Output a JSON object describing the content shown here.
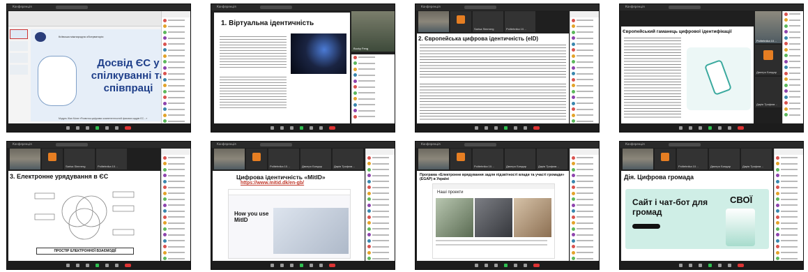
{
  "screenshot": {
    "title": "Zoom gallery of 8 shared-screen presentation captures"
  },
  "tiles": [
    {
      "id": "t1",
      "zoom_title": "Конференція",
      "slide_title_lines": [
        "Досвід ЄС у",
        "спілкуванні та",
        "співпраці"
      ],
      "slide_org": "Київська міжнародна обсерваторія",
      "slide_footer": "Модуль Жан Моне «Розвиток цифрових компетентностей фахових кадрів ЄС…»",
      "accent_color": "#3a4fa8"
    },
    {
      "id": "t2",
      "zoom_title": "Конференція",
      "slide_title": "1. Віртуальна ідентичність",
      "participants_visible": [
        "Bucky Feng"
      ]
    },
    {
      "id": "t3",
      "zoom_title": "Конференція",
      "slide_title": "2. Європейська цифрова ідентичність (eID)",
      "participants_visible": [
        "Sarisa Simmerg",
        "Politehnika 10…"
      ]
    },
    {
      "id": "t4",
      "zoom_title": "Конференція",
      "slide_title": "Європейський гаманець цифрової ідентифікації",
      "participants_visible": [
        "Politehnika 10…",
        "Дмитро Бондар",
        "Дарія Трофим…"
      ]
    },
    {
      "id": "t5",
      "zoom_title": "Конференція",
      "slide_title": "3. Електронне урядування в ЄС",
      "slide_footer": "ПРОСТІР ЕЛЕКТРОННОЇ ВЗАЄМОДІЇ",
      "participants_visible": [
        "Sarisa Simmerg",
        "Politehnika 10…"
      ]
    },
    {
      "id": "t6",
      "zoom_title": "Конференція",
      "slide_title": "Цифрова ідентичність «MitID»",
      "slide_link": "https://www.mitid.dk/en-gb/",
      "slide_body": "How you use MitID",
      "participants_visible": [
        "Politehnika 10…",
        "Дмитро Бондар",
        "Дарія Трофим…"
      ]
    },
    {
      "id": "t7",
      "zoom_title": "Конференція",
      "slide_title": "Програма «Електронне врядування задля підзвітності влади та участі громади» (EGAP) в Україні",
      "slide_section": "Наші проекти",
      "participants_visible": [
        "Politehnika 10…",
        "Дмитро Бондар",
        "Дарія Трофим…"
      ]
    },
    {
      "id": "t8",
      "zoom_title": "Конференція",
      "slide_title": "Дія. Цифрова громада",
      "slide_banner": "Сайт і чат-бот для громад",
      "slide_logo": "СВОЇ",
      "participants_visible": [
        "Politehnika 10…",
        "Дмитро Бондар",
        "Дарія Трофим…"
      ],
      "banner_color": "#cfeee6"
    }
  ]
}
